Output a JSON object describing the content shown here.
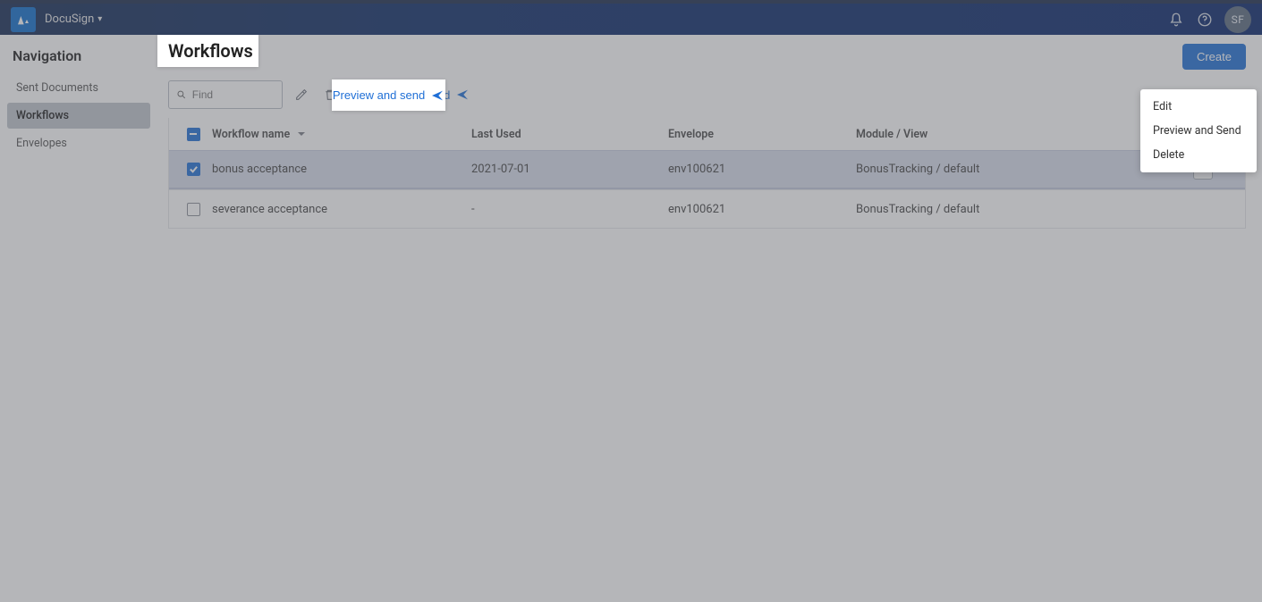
{
  "header": {
    "app_name": "DocuSign",
    "user_initials": "SF"
  },
  "sidebar": {
    "title": "Navigation",
    "items": [
      {
        "label": "Sent Documents"
      },
      {
        "label": "Workflows"
      },
      {
        "label": "Envelopes"
      }
    ]
  },
  "page": {
    "title": "Workflows",
    "create_label": "Create",
    "search_placeholder": "Find",
    "preview_send_label": "Preview and send"
  },
  "table": {
    "columns": {
      "workflow_name": "Workflow name",
      "last_used": "Last Used",
      "envelope": "Envelope",
      "module_view": "Module / View"
    },
    "rows": [
      {
        "checked": true,
        "name": "bonus acceptance",
        "last_used": "2021-07-01",
        "envelope": "env100621",
        "module_view": "BonusTracking / default"
      },
      {
        "checked": false,
        "name": "severance acceptance",
        "last_used": "-",
        "envelope": "env100621",
        "module_view": "BonusTracking / default"
      }
    ]
  },
  "context_menu": {
    "items": [
      {
        "label": "Edit"
      },
      {
        "label": "Preview and Send"
      },
      {
        "label": "Delete"
      }
    ]
  }
}
